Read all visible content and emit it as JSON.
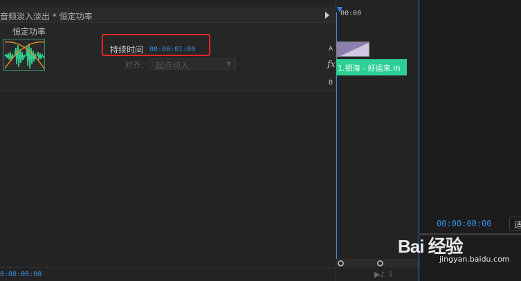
{
  "effect_controls": {
    "header_title": "音频淡入淡出 * 恒定功率",
    "effect_name": "恒定功率",
    "duration_label": "持续时间",
    "duration_value": "00:00:01:00",
    "align_label": "对齐:",
    "align_value": "起点切入",
    "bottom_timecode": "0:00:00:00"
  },
  "timeline": {
    "ruler_time": "00:00",
    "track_a_label": "A",
    "track_b_label": "B",
    "fx_label": "fx",
    "clip_name": "1.祖海 - 好运来.m"
  },
  "program": {
    "timecode": "00:00:00:00",
    "fit_label": "适"
  },
  "watermark": {
    "brand": "Bai 经验",
    "site": "jingyan.baidu.com"
  },
  "colors": {
    "accent_blue": "#3b8fe0",
    "highlight_red": "#e8262a",
    "clip_green": "#2ecf95"
  }
}
